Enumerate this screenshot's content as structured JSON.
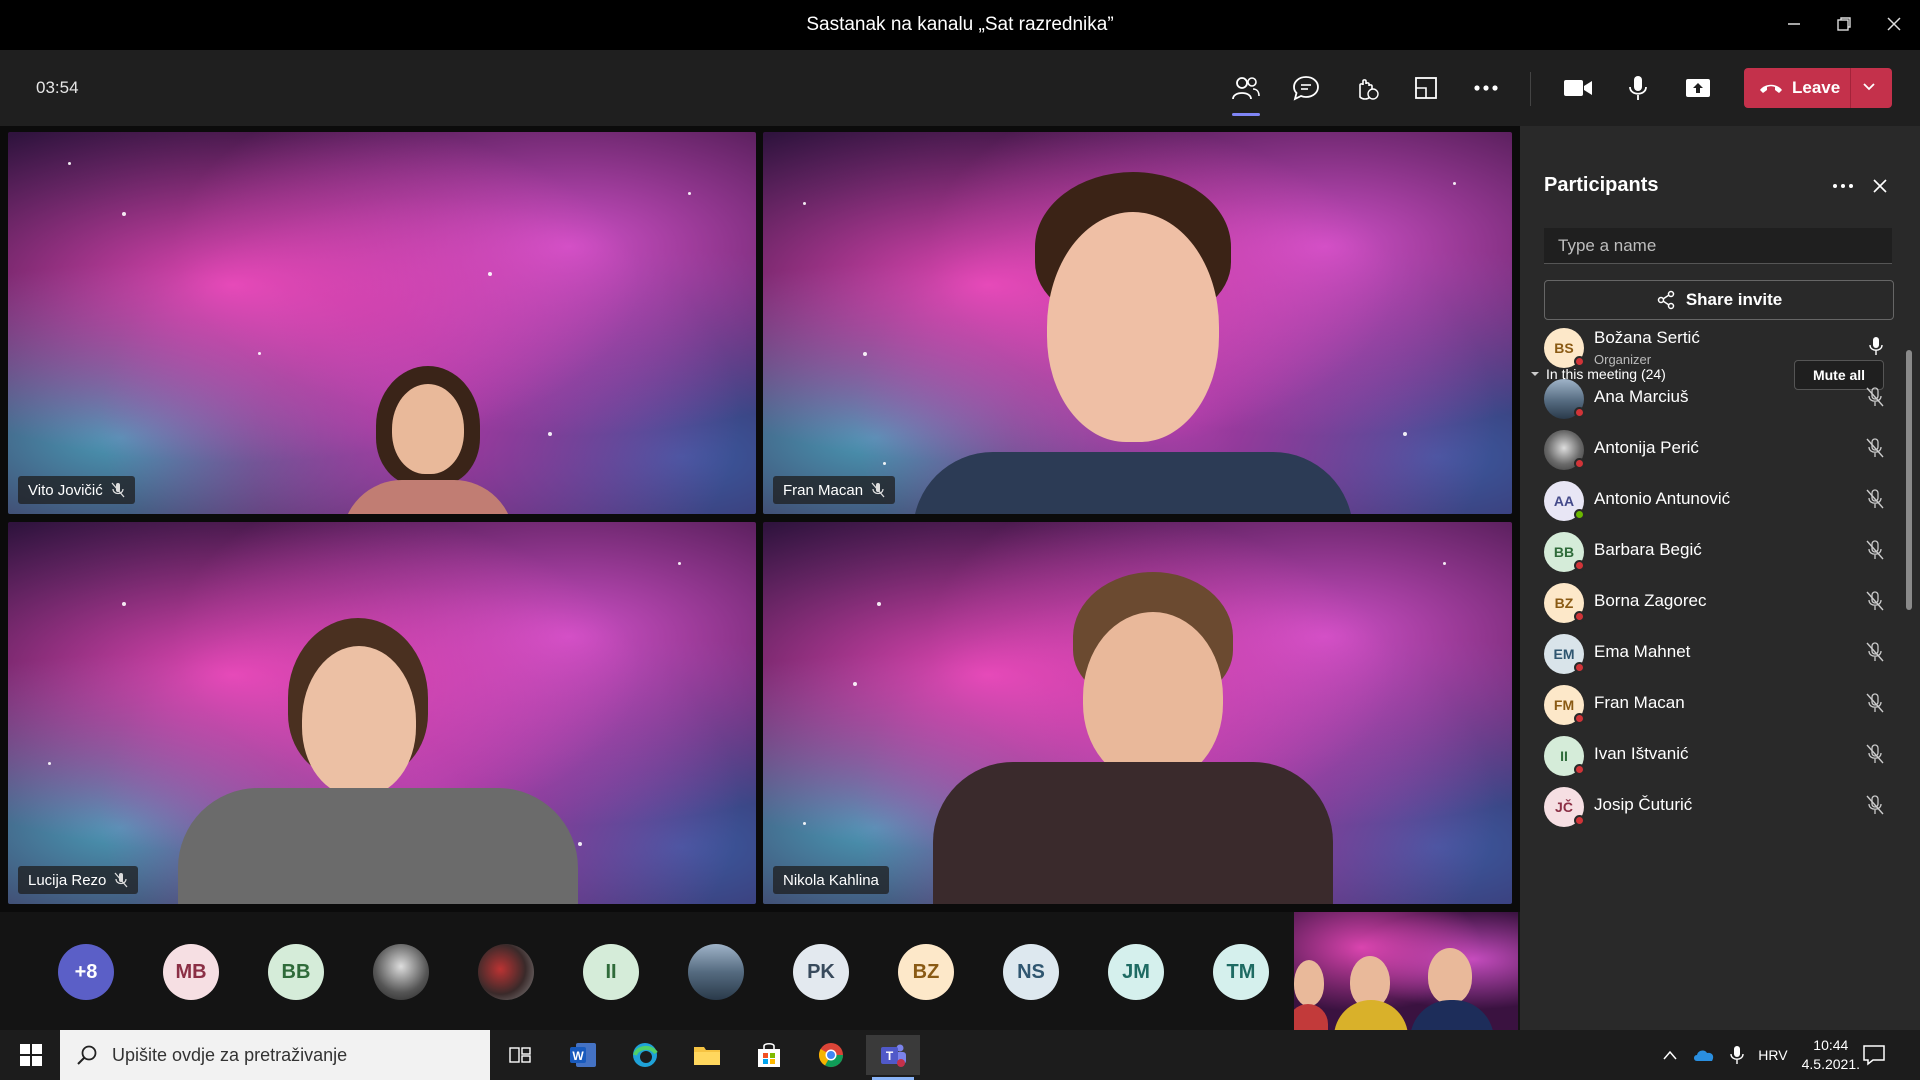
{
  "window": {
    "title": "Sastanak na kanalu „Sat razrednika”",
    "minimize_icon": "minimize-icon",
    "restore_icon": "restore-icon",
    "close_icon": "close-icon"
  },
  "toolbar": {
    "timer": "03:54",
    "leave_label": "Leave",
    "icons": [
      "participants-icon",
      "chat-icon",
      "reactions-icon",
      "rooms-icon",
      "more-icon",
      "camera-icon",
      "microphone-icon",
      "share-icon"
    ]
  },
  "videos": [
    {
      "name": "Vito Jovičić",
      "muted": true
    },
    {
      "name": "Fran Macan",
      "muted": true
    },
    {
      "name": "Lucija Rezo",
      "muted": true
    },
    {
      "name": "Nikola Kahlina",
      "muted": false
    }
  ],
  "strip": {
    "overflow": "+8",
    "avatars": [
      "MB",
      "BB",
      "",
      "",
      "II",
      "",
      "PK",
      "BZ",
      "NS",
      "JM",
      "TM"
    ]
  },
  "panel": {
    "title": "Participants",
    "search_placeholder": "Type a name",
    "share_invite": "Share invite",
    "in_meeting": "In this meeting (24)",
    "mute_all": "Mute all",
    "participants": [
      {
        "initials": "BS",
        "name": "Božana Sertić",
        "role": "Organizer",
        "mic": "on",
        "status": "busy"
      },
      {
        "initials": "",
        "name": "Ana Marciuš",
        "role": "",
        "mic": "off",
        "status": "busy"
      },
      {
        "initials": "",
        "name": "Antonija Perić",
        "role": "",
        "mic": "off",
        "status": "busy"
      },
      {
        "initials": "AA",
        "name": "Antonio Antunović",
        "role": "",
        "mic": "off",
        "status": "available"
      },
      {
        "initials": "BB",
        "name": "Barbara Begić",
        "role": "",
        "mic": "off",
        "status": "busy"
      },
      {
        "initials": "BZ",
        "name": "Borna Zagorec",
        "role": "",
        "mic": "off",
        "status": "busy"
      },
      {
        "initials": "EM",
        "name": "Ema Mahnet",
        "role": "",
        "mic": "off",
        "status": "busy"
      },
      {
        "initials": "FM",
        "name": "Fran Macan",
        "role": "",
        "mic": "off",
        "status": "busy"
      },
      {
        "initials": "II",
        "name": "Ivan Ištvanić",
        "role": "",
        "mic": "off",
        "status": "busy"
      },
      {
        "initials": "JČ",
        "name": "Josip Čuturić",
        "role": "",
        "mic": "off",
        "status": "busy"
      }
    ]
  },
  "taskbar": {
    "search_placeholder": "Upišite ovdje za pretraživanje",
    "language": "HRV",
    "time": "10:44",
    "date": "4.5.2021."
  }
}
